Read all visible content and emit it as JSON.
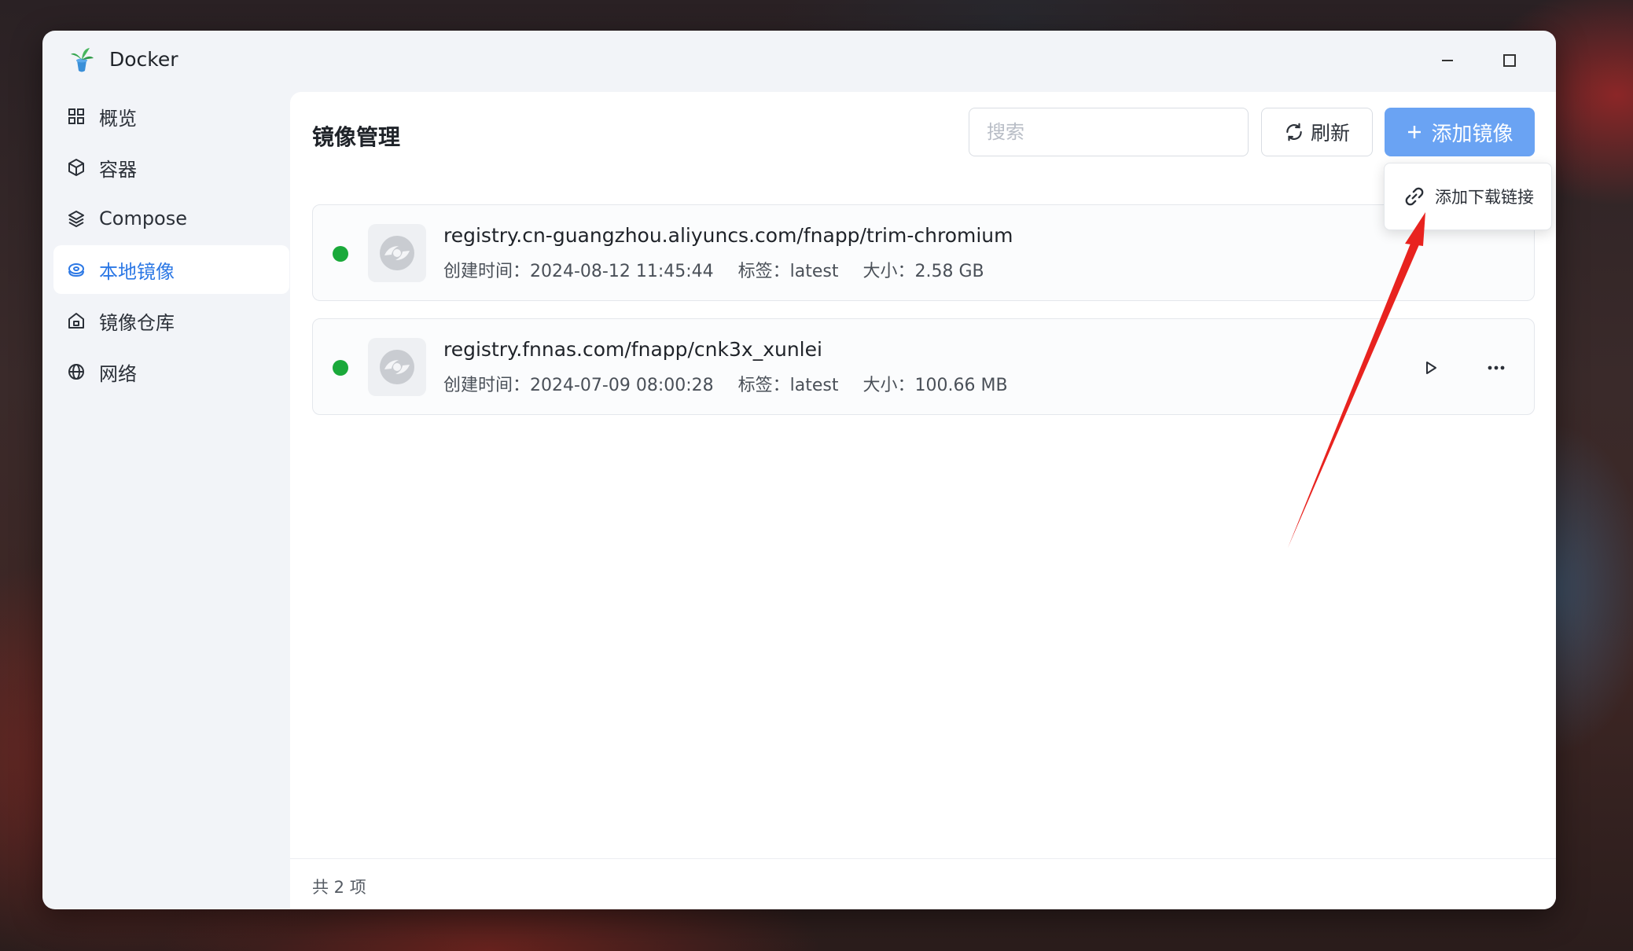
{
  "window": {
    "title": "Docker"
  },
  "sidebar": {
    "items": [
      {
        "label": "概览",
        "icon": "grid-icon",
        "active": false
      },
      {
        "label": "容器",
        "icon": "box-icon",
        "active": false
      },
      {
        "label": "Compose",
        "icon": "layers-icon",
        "active": false
      },
      {
        "label": "本地镜像",
        "icon": "disc-icon",
        "active": true
      },
      {
        "label": "镜像仓库",
        "icon": "warehouse-icon",
        "active": false
      },
      {
        "label": "网络",
        "icon": "globe-icon",
        "active": false
      }
    ]
  },
  "main": {
    "title": "镜像管理",
    "search_placeholder": "搜索",
    "refresh_label": "刷新",
    "add_label": "添加镜像",
    "dropdown_item": "添加下载链接",
    "images": [
      {
        "name": "registry.cn-guangzhou.aliyuncs.com/fnapp/trim-chromium",
        "created": "创建时间：2024-08-12 11:45:44",
        "tag": "标签：latest",
        "size": "大小：2.58 GB",
        "status": "running"
      },
      {
        "name": "registry.fnnas.com/fnapp/cnk3x_xunlei",
        "created": "创建时间：2024-07-09 08:00:28",
        "tag": "标签：latest",
        "size": "大小：100.66 MB",
        "status": "running"
      }
    ],
    "footer": "共 2 项"
  },
  "colors": {
    "accent": "#2c78e5",
    "primary_button": "#6aa3f3",
    "status_ok": "#1aa93a",
    "annotation_arrow": "#e8231f"
  }
}
